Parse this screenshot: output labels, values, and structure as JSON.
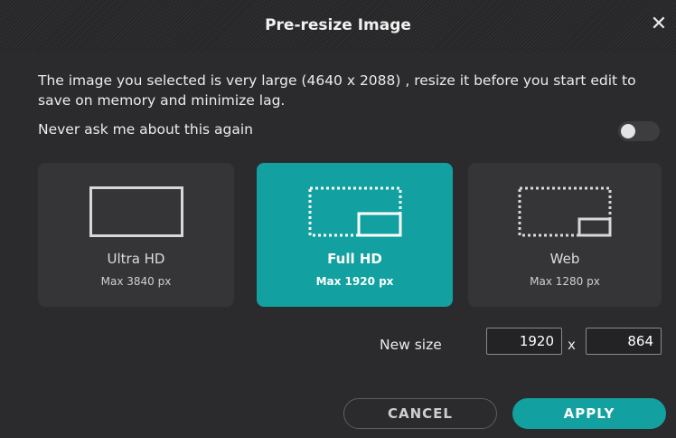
{
  "dialog": {
    "title": "Pre-resize Image",
    "close_icon": "close-icon",
    "message": "The image you selected is very large (4640 x 2088) , resize it before you start edit to save on memory and minimize lag.",
    "never_ask_label": "Never ask me about this again",
    "never_ask_enabled": false
  },
  "presets": [
    {
      "label": "Ultra HD",
      "sub": "Max 3840 px",
      "icon": "ultra-hd-frame-icon",
      "selected": false
    },
    {
      "label": "Full HD",
      "sub": "Max 1920 px",
      "icon": "full-hd-frame-icon",
      "selected": true
    },
    {
      "label": "Web",
      "sub": "Max 1280 px",
      "icon": "web-frame-icon",
      "selected": false
    }
  ],
  "new_size": {
    "label": "New size",
    "width": "1920",
    "separator": "x",
    "height": "864"
  },
  "buttons": {
    "cancel": "CANCEL",
    "apply": "APPLY"
  },
  "colors": {
    "accent": "#12a0a0",
    "dialog_bg": "#2b2b2d",
    "card_bg": "#353538"
  }
}
